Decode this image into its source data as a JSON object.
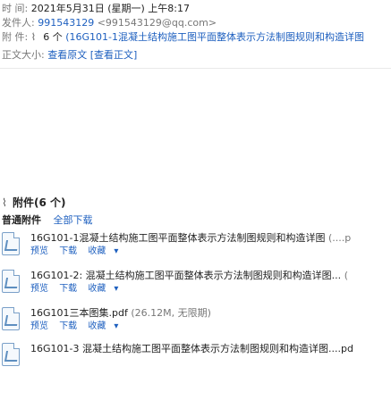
{
  "header": {
    "time_label": "时 间:",
    "time_value": "2021年5月31日 (星期一) 上午8:17",
    "sender_label": "发件人:",
    "sender_name": "991543129",
    "sender_email": "<991543129@qq.com>",
    "attach_label": "附 件:",
    "attach_count": "6 个",
    "attach_inline": "(16G101-1混凝土结构施工图平面整体表示方法制图规则和构造详图",
    "body_label": "正文大小:",
    "body_actions": [
      "查看原文",
      "[查看正文]"
    ]
  },
  "attachments": {
    "heading": "附件(6 个)",
    "tabs": [
      "普通附件",
      "全部下载"
    ],
    "files": [
      {
        "name": "16G101-1混凝土结构施工图平面整体表示方法制图规则和构造详图",
        "size": "(....p",
        "actions": [
          "预览",
          "下载",
          "收藏"
        ]
      },
      {
        "name": "16G101-2: 混凝土结构施工图平面整体表示方法制图规则和构造详图...",
        "size": "(",
        "actions": [
          "预览",
          "下载",
          "收藏"
        ]
      },
      {
        "name": "16G101三本图集.pdf",
        "size": "(26.12M, 无限期)",
        "actions": [
          "预览",
          "下载",
          "收藏"
        ]
      },
      {
        "name": "16G101-3 混凝土结构施工图平面整体表示方法制图规则和构造详图....pd",
        "size": "",
        "actions": []
      }
    ]
  }
}
